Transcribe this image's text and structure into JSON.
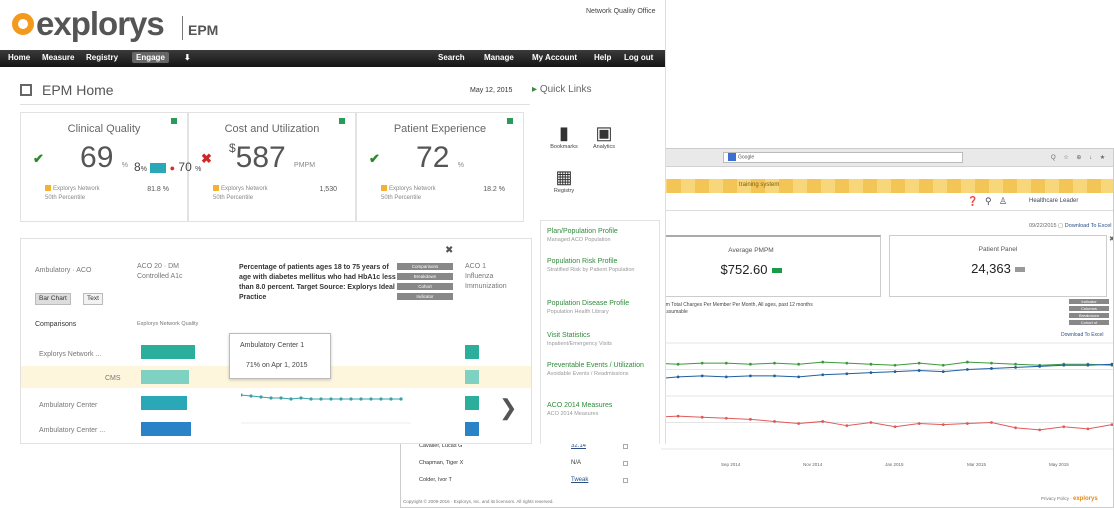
{
  "back_window": {
    "url_text": "Google",
    "toolbar_icons": "Q ☆ ⊕ ↓ ★",
    "banner_text": "training system",
    "user_label": "Healthcare Leader",
    "date_text": "09/22/2015",
    "download_label": "Download To Excel",
    "cards": [
      {
        "title": "Average PMPM",
        "value": "$752.60"
      },
      {
        "title": "Patient Panel",
        "value": "24,363"
      }
    ],
    "chart_caption_line1": "um Total Charges Per Member Per Month, All ages, past 12 months",
    "chart_caption_line2": "Assumable",
    "chart_buttons": [
      "Indicator",
      "Columns",
      "Breakdown",
      "Cohort of"
    ],
    "chart_download": "Download To Excel",
    "chart_data": {
      "type": "line",
      "x_labels": [
        "Sep 2014",
        "Nov 2014",
        "Jan 2015",
        "Mar 2015",
        "May 2015"
      ],
      "series": [
        {
          "name": "",
          "color": "#3a9a3a",
          "values": [
            81,
            80,
            81,
            81,
            80,
            81,
            80,
            82,
            81,
            80,
            79,
            81,
            79,
            82,
            81,
            80,
            79,
            80,
            80,
            79
          ]
        },
        {
          "name": "",
          "color": "#1f5fa0",
          "values": [
            66,
            68,
            69,
            68,
            69,
            69,
            68,
            70,
            71,
            72,
            73,
            74,
            73,
            75,
            76,
            77,
            78,
            79,
            79,
            80
          ]
        },
        {
          "name": "",
          "color": "#e05a5a",
          "values": [
            30,
            31,
            30,
            29,
            28,
            26,
            24,
            26,
            22,
            25,
            21,
            24,
            23,
            24,
            25,
            20,
            18,
            21,
            19,
            23
          ]
        }
      ]
    },
    "table_rows": [
      {
        "name": "Cavalier, Lucas G",
        "value": "32.14",
        "link": true
      },
      {
        "name": "Chapman, Tiger X",
        "value": "N/A",
        "link": false
      },
      {
        "name": "Colder, Ivor T",
        "value": "Tweak",
        "link": true
      }
    ],
    "footer_left": "Copyright © 2009-2016 · Explorys, Inc. and its licensors. All rights reserved.",
    "footer_right_prefix": "Privacy Policy",
    "footer_brand": "explorys"
  },
  "front_window": {
    "logo_text": "explorys",
    "logo_suffix": "EPM",
    "top_right_text": "Network Quality Office",
    "nav_left": [
      "Home",
      "Measure",
      "Registry",
      "Engage",
      "⬇"
    ],
    "nav_right": [
      "Search",
      "Manage",
      "My Account",
      "Help",
      "Log out"
    ],
    "page_title": "EPM Home",
    "date": "May 12, 2015",
    "quick_links_title": "Quick Links",
    "cards": [
      {
        "title": "Clinical Quality",
        "mark": "✔",
        "mark_color": "#2a8a2a",
        "prefix": "",
        "value": "69",
        "unit": "%",
        "network_label": "Explorys Network",
        "network_sub": "50th Percentile",
        "network_value": "81.8 %"
      },
      {
        "title": "Cost and Utilization",
        "mark": "✖",
        "mark_color": "#cc2a2a",
        "prefix": "$",
        "value": "587",
        "unit": "PMPM",
        "network_label": "Explorys Network",
        "network_sub": "50th Percentile",
        "network_value": "1,530"
      },
      {
        "title": "Patient Experience",
        "mark": "✔",
        "mark_color": "#2a8a2a",
        "prefix": "",
        "value": "72",
        "unit": "%",
        "network_label": "Explorys Network",
        "network_sub": "50th Percentile",
        "network_value": "18.2 %"
      }
    ],
    "quick_tiles": [
      {
        "icon": "bookmark-icon",
        "glyph": "▮",
        "label": "Bookmarks"
      },
      {
        "icon": "analytics-icon",
        "glyph": "▣",
        "label": "Analytics"
      },
      {
        "icon": "registry-icon",
        "glyph": "▦",
        "label": "Registry"
      }
    ],
    "quick_links": [
      {
        "title": "Plan/Population Profile",
        "sub": "Managed ACO Population"
      },
      {
        "title": "Population Risk Profile",
        "sub": "Stratified Risk by Patient Population"
      },
      {
        "title": "Population Disease Profile",
        "sub": "Population Health Library"
      },
      {
        "title": "Visit Statistics",
        "sub": "Inpatient/Emergency Visits"
      },
      {
        "title": "Preventable Events / Utilization",
        "sub": "Avoidable Events / Readmissions"
      },
      {
        "title": "ACO 2014 Measures",
        "sub": "ACO 2014 Measures"
      }
    ],
    "panel": {
      "col1_label": "Ambulatory · ACO",
      "col2_label": "ACO 20 · DM",
      "col2_sub": "Controlled A1c",
      "toggle_bar": "Bar Chart",
      "toggle_text": "Text",
      "comparison_label": "Comparisons",
      "comparison_value": "Explorys Network Quality",
      "rows": [
        "Explorys Network ...",
        "CMS",
        "Ambulatory Center",
        "Ambulatory Center ..."
      ],
      "measure_desc": "Percentage of patients ages 18 to 75 years of age with diabetes mellitus who had HbA1c less than 8.0 percent. Target Source: Explorys Ideal Practice",
      "tags": [
        "Comparisons",
        "Breakdown",
        "Cohort",
        "Indicator"
      ],
      "pct_a": "8",
      "pct_unit_a": "%",
      "pct_b": "70",
      "pct_unit_b": "%",
      "tooltip_a": "Ambulatory Center 1",
      "tooltip_b": "71% on Apr 1, 2015",
      "right_col_label": "ACO 1",
      "right_col_sub": "Influenza",
      "right_col_sub2": "Immunization",
      "next_arrow": "❯"
    }
  }
}
